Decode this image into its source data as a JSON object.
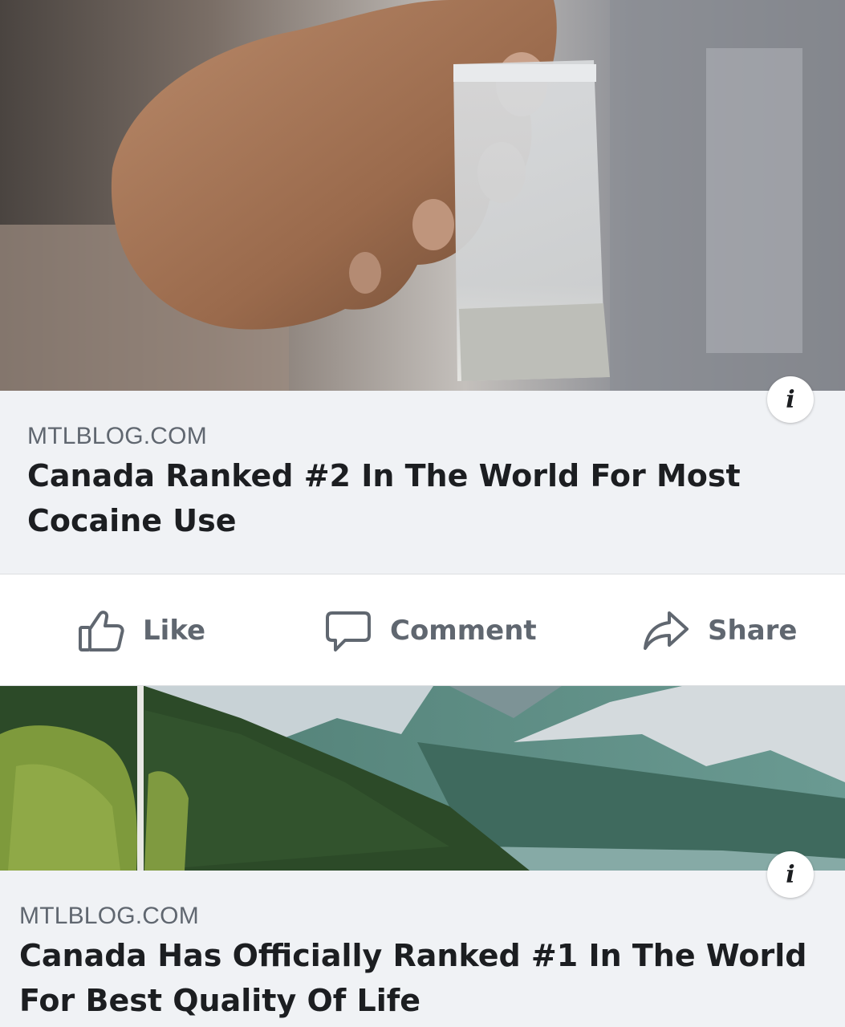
{
  "posts": [
    {
      "source": "MTLBLOG.COM",
      "headline": "Canada Ranked #2 In The World For Most Cocaine Use",
      "info_glyph": "i",
      "image_icon": "hand-holding-bag-photo"
    },
    {
      "source": "MTLBLOG.COM",
      "headline": "Canada Has Officially Ranked #1 In The World For Best Quality Of Life",
      "info_glyph": "i",
      "image_icon": "mountain-forest-photo"
    }
  ],
  "actions": {
    "like_label": "Like",
    "comment_label": "Comment",
    "share_label": "Share"
  },
  "colors": {
    "card_background": "#f0f2f5",
    "headline_text": "#1c1e21",
    "secondary_text": "#606770",
    "divider": "#dddfe2"
  }
}
